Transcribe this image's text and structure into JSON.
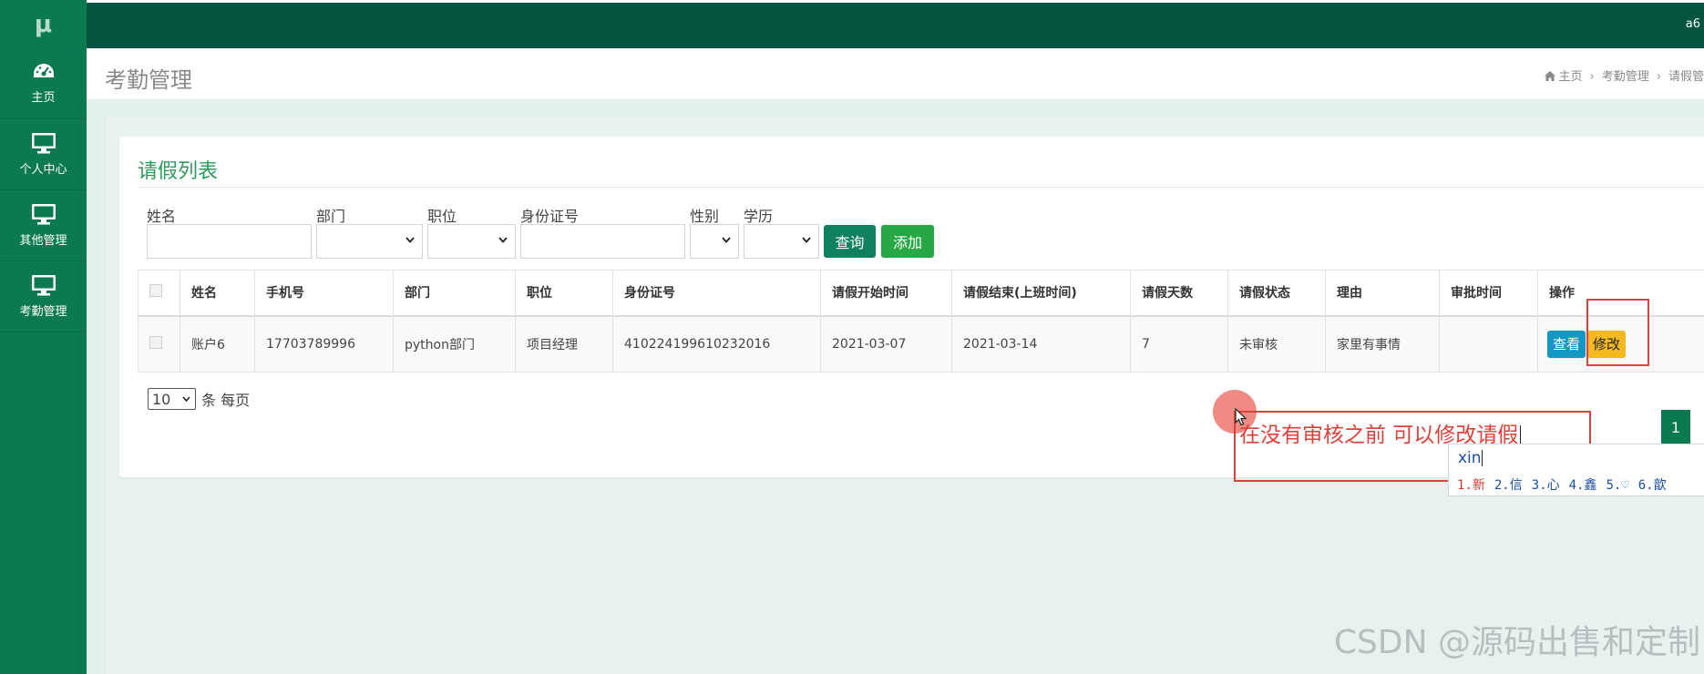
{
  "app": {
    "logo": "μ",
    "user": "a6"
  },
  "sidebar": {
    "items": [
      {
        "label": "主页",
        "icon": "dashboard-icon"
      },
      {
        "label": "个人中心",
        "icon": "monitor-icon"
      },
      {
        "label": "其他管理",
        "icon": "monitor-icon"
      },
      {
        "label": "考勤管理",
        "icon": "monitor-icon"
      }
    ]
  },
  "header": {
    "title": "考勤管理",
    "breadcrumb": [
      "主页",
      "考勤管理",
      "请假管"
    ]
  },
  "card": {
    "title": "请假列表",
    "filters": {
      "name_label": "姓名",
      "dept_label": "部门",
      "position_label": "职位",
      "idcard_label": "身份证号",
      "gender_label": "性别",
      "education_label": "学历"
    },
    "query_btn": "查询",
    "add_btn": "添加"
  },
  "table": {
    "headers": [
      "姓名",
      "手机号",
      "部门",
      "职位",
      "身份证号",
      "请假开始时间",
      "请假结束(上班时间)",
      "请假天数",
      "请假状态",
      "理由",
      "审批时间",
      "操作"
    ],
    "rows": [
      [
        "账户6",
        "17703789996",
        "python部门",
        "项目经理",
        "410224199610232016",
        "2021-03-07",
        "2021-03-14",
        "7",
        "未审核",
        "家里有事情",
        ""
      ]
    ],
    "view_btn": "查看",
    "edit_btn": "修改"
  },
  "pagination": {
    "page_size": "10",
    "page_size_suffix": "条 每页",
    "current_page": "1"
  },
  "annotation": {
    "note": "在没有审核之前  可以修改请假"
  },
  "ime": {
    "composition": "xin",
    "candidates": [
      "1.新",
      "2.信",
      "3.心",
      "4.鑫",
      "5.♡",
      "6.歆"
    ]
  },
  "watermark": "CSDN @源码出售和定制",
  "colors": {
    "sidebar": "#0b7a4f",
    "topbar": "#045540",
    "accent_green": "#2e9a5d",
    "query_btn": "#11805e",
    "add_btn": "#28a745",
    "view_btn": "#1497c2",
    "edit_btn": "#f4b920",
    "annotation_red": "#e0403a"
  }
}
